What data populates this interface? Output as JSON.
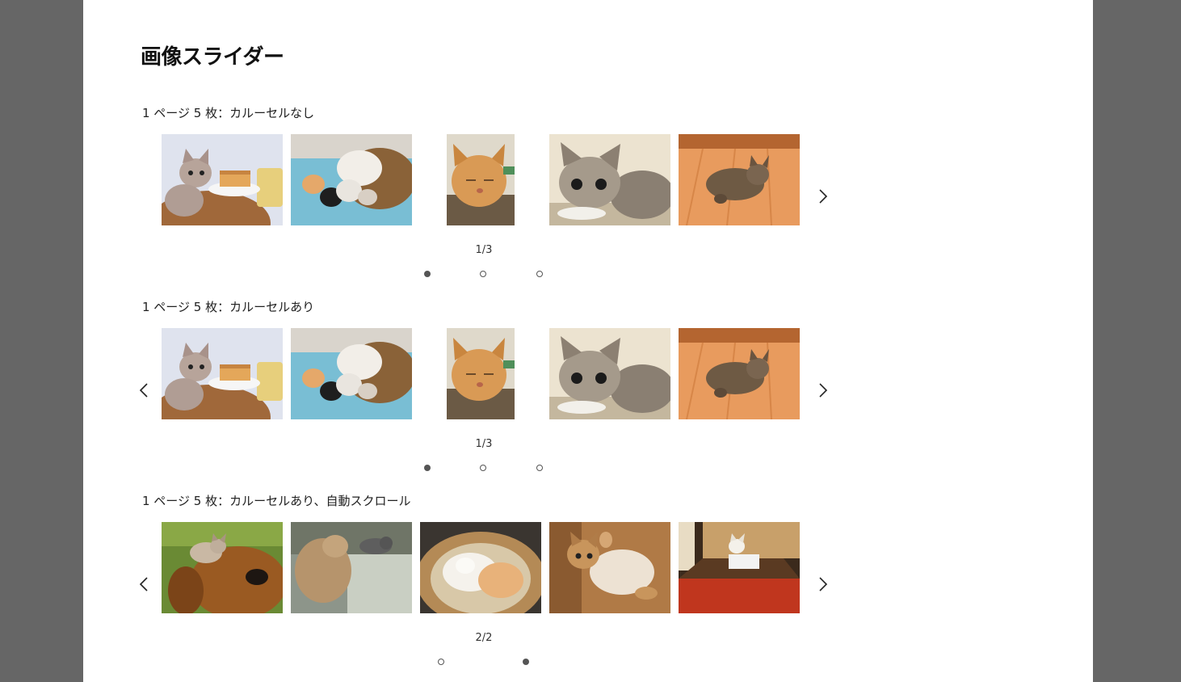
{
  "page": {
    "title": "画像スライダー"
  },
  "sliders": [
    {
      "label": "1 ページ 5 枚：カルーセルなし",
      "counter": "1/3",
      "has_prev": false,
      "has_next": true,
      "images": [
        {
          "subject": "kitten-with-cake"
        },
        {
          "subject": "cat-with-kittens-on-blanket"
        },
        {
          "subject": "orange-cat-sleeping"
        },
        {
          "subject": "kitten-lying"
        },
        {
          "subject": "kitten-on-wood-floor"
        }
      ],
      "pages": 3,
      "active_page": 1
    },
    {
      "label": "1 ページ 5 枚：カルーセルあり",
      "counter": "1/3",
      "has_prev": true,
      "has_next": true,
      "images": [
        {
          "subject": "kitten-with-cake"
        },
        {
          "subject": "cat-with-kittens-on-blanket"
        },
        {
          "subject": "orange-cat-sleeping"
        },
        {
          "subject": "kitten-lying"
        },
        {
          "subject": "kitten-on-wood-floor"
        }
      ],
      "pages": 3,
      "active_page": 1
    },
    {
      "label": "1 ページ 5 枚：カルーセルあり、自動スクロール",
      "counter": "2/2",
      "has_prev": true,
      "has_next": true,
      "images": [
        {
          "subject": "kitten-on-dog-head"
        },
        {
          "subject": "cats-in-bathroom"
        },
        {
          "subject": "white-and-ginger-cats-curled"
        },
        {
          "subject": "kitten-playing-on-floor"
        },
        {
          "subject": "cat-on-kotatsu"
        }
      ],
      "pages": 2,
      "active_page": 2
    }
  ],
  "icons": {
    "prev": "chevron-left-icon",
    "next": "chevron-right-icon"
  },
  "colors": {
    "backdrop": "#666666",
    "page": "#ffffff",
    "dot": "#555555"
  }
}
